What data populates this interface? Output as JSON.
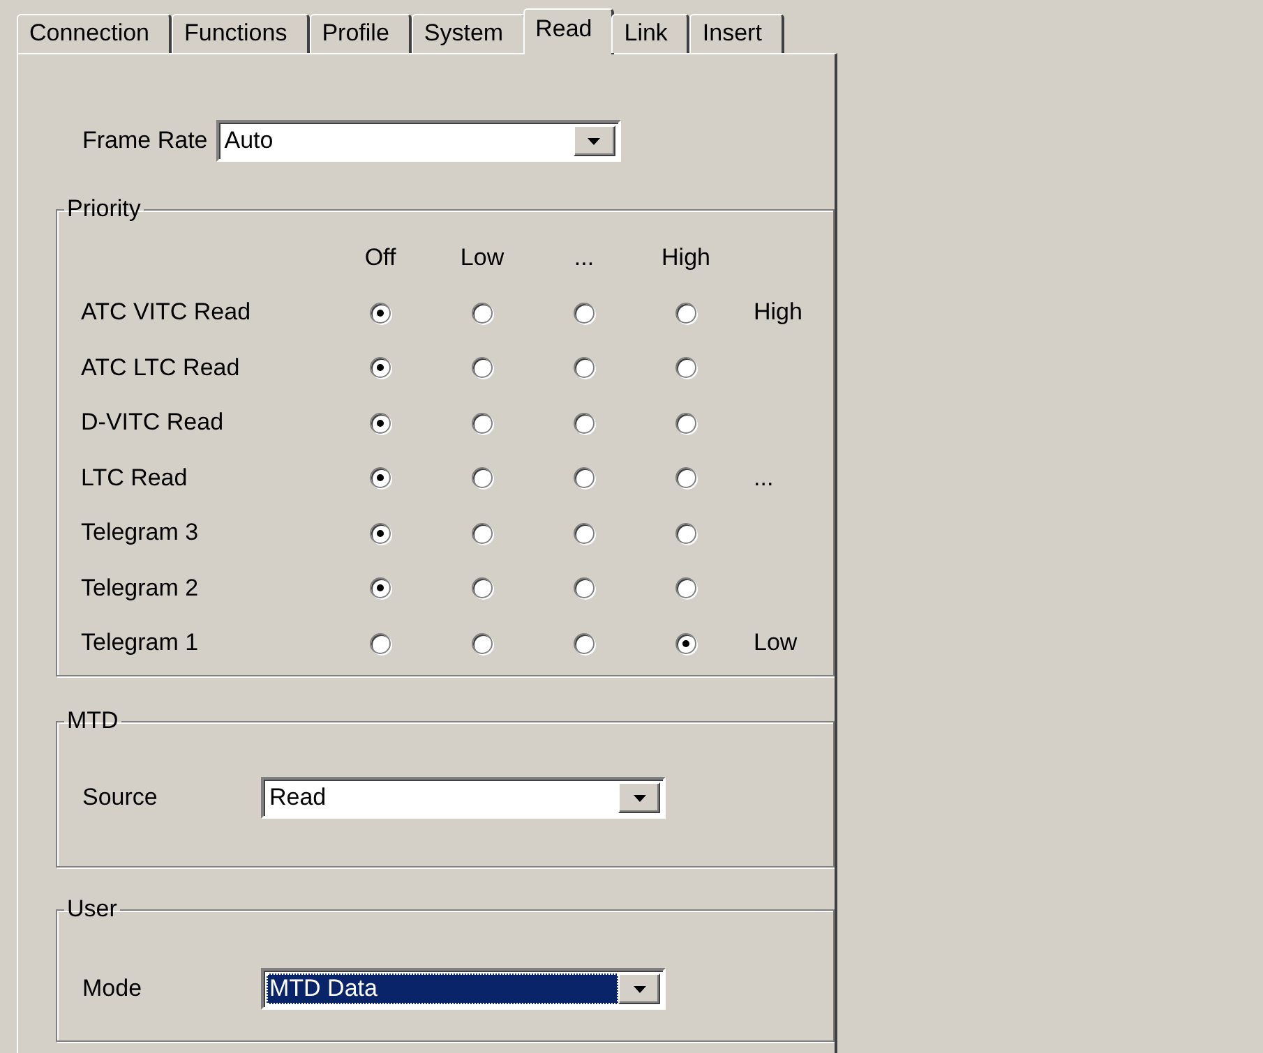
{
  "tabs": [
    {
      "label": "Connection",
      "selected": false
    },
    {
      "label": "Functions",
      "selected": false
    },
    {
      "label": "Profile",
      "selected": false
    },
    {
      "label": "System",
      "selected": false
    },
    {
      "label": "Read",
      "selected": true
    },
    {
      "label": "Link",
      "selected": false
    },
    {
      "label": "Insert",
      "selected": false
    }
  ],
  "frame_rate": {
    "label": "Frame Rate",
    "value": "Auto",
    "highlighted": false
  },
  "priority": {
    "title": "Priority",
    "columns": [
      "Off",
      "Low",
      "...",
      "High"
    ],
    "rows": [
      {
        "label": "ATC VITC Read",
        "options": [
          {
            "selected": true
          },
          {
            "selected": false
          },
          {
            "selected": false
          },
          {
            "selected": false
          }
        ],
        "side_label": "High"
      },
      {
        "label": "ATC LTC Read",
        "options": [
          {
            "selected": true
          },
          {
            "selected": false
          },
          {
            "selected": false
          },
          {
            "selected": false
          }
        ]
      },
      {
        "label": "D-VITC Read",
        "options": [
          {
            "selected": true
          },
          {
            "selected": false
          },
          {
            "selected": false
          },
          {
            "selected": false
          }
        ]
      },
      {
        "label": "LTC Read",
        "options": [
          {
            "selected": true
          },
          {
            "selected": false
          },
          {
            "selected": false
          },
          {
            "selected": false
          }
        ],
        "side_label": "..."
      },
      {
        "label": "Telegram 3",
        "options": [
          {
            "selected": true
          },
          {
            "selected": false
          },
          {
            "selected": false
          },
          {
            "selected": false
          }
        ]
      },
      {
        "label": "Telegram 2",
        "options": [
          {
            "selected": true
          },
          {
            "selected": false
          },
          {
            "selected": false
          },
          {
            "selected": false
          }
        ]
      },
      {
        "label": "Telegram 1",
        "options": [
          {
            "selected": false
          },
          {
            "selected": false
          },
          {
            "selected": false
          },
          {
            "selected": true
          }
        ],
        "side_label": "Low"
      }
    ]
  },
  "mtd": {
    "title": "MTD",
    "label": "Source",
    "value": "Read",
    "highlighted": false
  },
  "user": {
    "title": "User",
    "label": "Mode",
    "value": "MTD Data",
    "highlighted": true
  }
}
